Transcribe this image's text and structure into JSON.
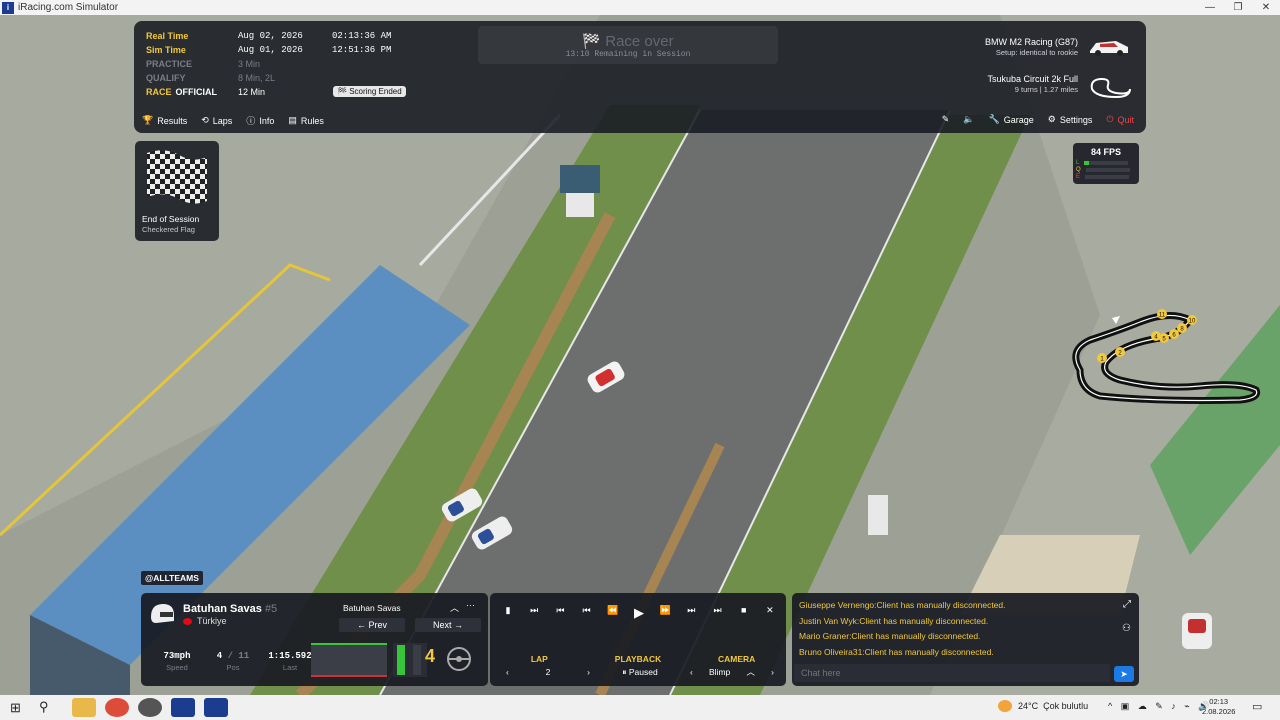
{
  "window": {
    "title": "iRacing.com Simulator"
  },
  "session": {
    "real_time_label": "Real Time",
    "real_time_date": "Aug 02, 2026",
    "real_time_clock": "02:13:36 AM",
    "sim_time_label": "Sim Time",
    "sim_time_date": "Aug 01, 2026",
    "sim_time_clock": "12:51:36 PM",
    "practice_label": "PRACTICE",
    "practice_value": "3 Min",
    "qualify_label": "QUALIFY",
    "qualify_value": "8 Min, 2L",
    "race_label": "RACE",
    "race_official": "OFFICIAL",
    "race_value": "12 Min",
    "scoring_badge": "Scoring Ended",
    "status_title": "Race over",
    "status_sub": "13:10 Remaining in Session"
  },
  "car": {
    "name": "BMW M2 Racing (G87)",
    "setup": "Setup: identical to rookie"
  },
  "track": {
    "name": "Tsukuba Circuit 2k Full",
    "details": "9 turns  |  1.27 miles"
  },
  "nav": {
    "results": "Results",
    "laps": "Laps",
    "info": "Info",
    "rules": "Rules",
    "garage": "Garage",
    "settings": "Settings",
    "quit": "Quit"
  },
  "flag": {
    "title": "End of Session",
    "subtitle": "Checkered Flag"
  },
  "fps": {
    "value": "84 FPS",
    "rows": [
      "L",
      "Q",
      "E"
    ],
    "level": 0.1,
    "colors": {
      "good": "#37c63a",
      "warn": "#f2c83c",
      "bad": "#e74a4a"
    }
  },
  "map_markers": [
    "1",
    "2",
    "4",
    "5",
    "6",
    "8",
    "10",
    "11"
  ],
  "team_tag": "@ALLTEAMS",
  "driver": {
    "name": "Batuhan Savas",
    "number": "#5",
    "country": "Türkiye",
    "selector_name": "Batuhan Savas",
    "prev": "← Prev",
    "next": "Next →",
    "speed": "73mph",
    "speed_label": "Speed",
    "pos": "4",
    "pos_total": "/ 11",
    "pos_label": "Pos",
    "last": "1:15.592",
    "last_label": "Last",
    "gear": "4"
  },
  "replay": {
    "lap_label": "LAP",
    "lap_value": "2",
    "playback_label": "PLAYBACK",
    "playback_value": "⏸ Paused",
    "camera_label": "CAMERA",
    "camera_value": "Blimp"
  },
  "chat": {
    "messages": [
      "Giuseppe Vernengo:Client has manually disconnected.",
      "Justin Van Wyk:Client has manually disconnected.",
      "Mario Graner:Client has manually disconnected.",
      "Bruno Oliveira31:Client has manually disconnected."
    ],
    "placeholder": "Chat here"
  },
  "taskbar": {
    "weather_temp": "24°C",
    "weather_text": "Çok bulutlu",
    "time": "02:13",
    "date": "2.08.2026"
  }
}
